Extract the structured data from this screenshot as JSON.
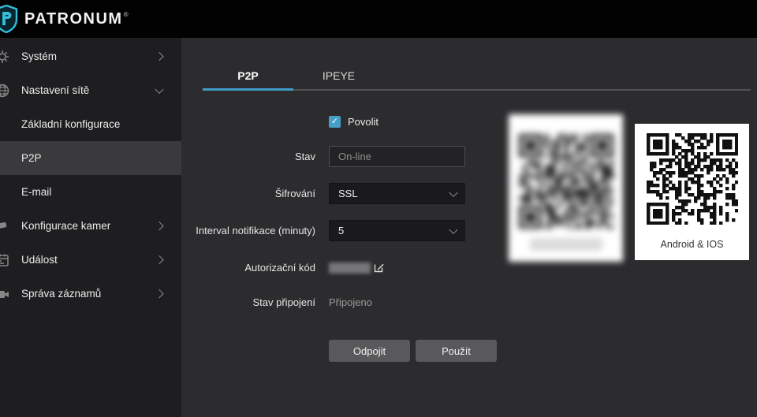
{
  "header": {
    "logo_text": "PATRONUM",
    "logo_reg": "®",
    "logo_icon": "shield-logo-icon"
  },
  "sidebar": {
    "items": [
      {
        "name": "system",
        "label": "Systém",
        "icon": "system-icon",
        "chevron": "right",
        "type": "top"
      },
      {
        "name": "network-settings",
        "label": "Nastavení sítě",
        "icon": "network-icon",
        "chevron": "down",
        "type": "top",
        "expanded": true
      },
      {
        "name": "basic-config",
        "label": "Základní konfigurace",
        "type": "sub"
      },
      {
        "name": "p2p",
        "label": "P2P",
        "type": "sub",
        "selected": true
      },
      {
        "name": "email",
        "label": "E-mail",
        "type": "sub"
      },
      {
        "name": "camera-config",
        "label": "Konfigurace kamer",
        "icon": "camera-icon",
        "chevron": "right",
        "type": "top"
      },
      {
        "name": "event",
        "label": "Událost",
        "icon": "event-icon",
        "chevron": "right",
        "type": "top"
      },
      {
        "name": "records",
        "label": "Správa záznamů",
        "icon": "records-icon",
        "chevron": "right",
        "type": "top"
      }
    ]
  },
  "tabs": [
    {
      "name": "p2p",
      "label": "P2P",
      "active": true
    },
    {
      "name": "ipeye",
      "label": "IPEYE",
      "active": false
    }
  ],
  "form": {
    "enable": {
      "label": "Povolit",
      "checked": true
    },
    "status": {
      "label": "Stav",
      "value": "On-line"
    },
    "encryption": {
      "label": "Šifrování",
      "value": "SSL"
    },
    "interval": {
      "label": "Interval notifikace (minuty)",
      "value": "5"
    },
    "auth_code": {
      "label": "Autorizační kód",
      "value_hidden": true,
      "edit_icon": "edit-icon"
    },
    "connection": {
      "label": "Stav připojení",
      "value": "Připojeno"
    },
    "buttons": [
      {
        "name": "disconnect",
        "label": "Odpojit"
      },
      {
        "name": "apply",
        "label": "Použít"
      }
    ]
  },
  "qr": {
    "device_card": {
      "blurred": true
    },
    "app_card": {
      "label": "Android & IOS"
    }
  },
  "colors": {
    "accent": "#3f9dc9",
    "checkbox": "#46a0c6",
    "topbar": "#020203",
    "sidebar": "#1e1e20",
    "sidebar_selected": "#3a3a3c",
    "main": "#2c2c2e",
    "logo_cyan": "#35bcd4"
  }
}
